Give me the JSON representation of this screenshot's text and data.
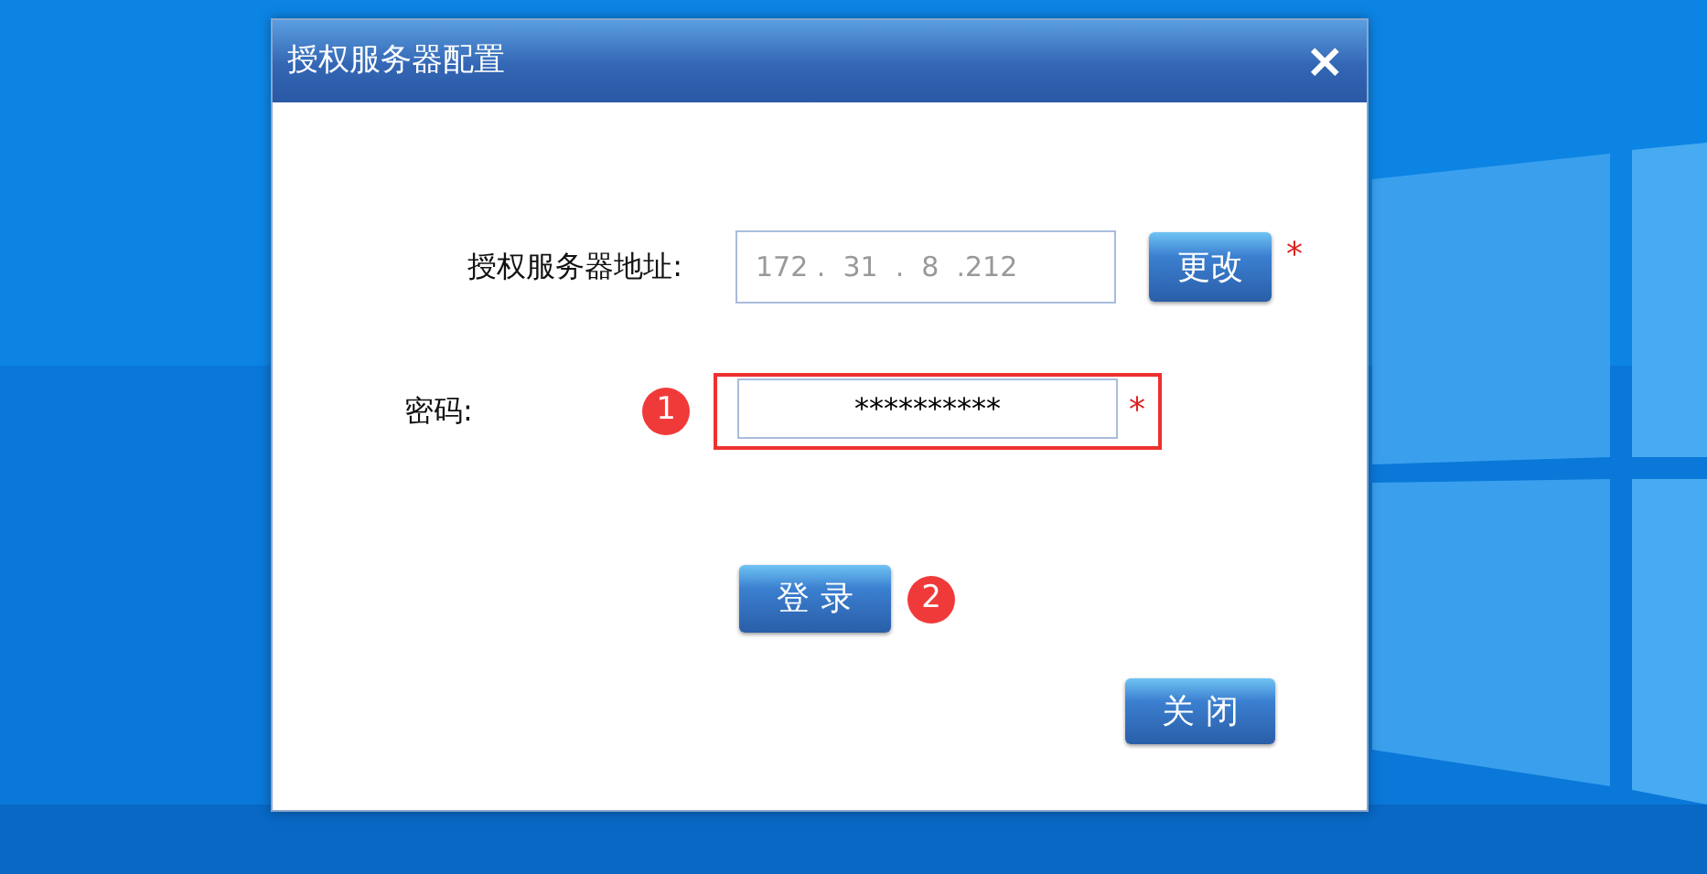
{
  "dialog": {
    "title": "授权服务器配置",
    "close_glyph": "×"
  },
  "address": {
    "label": "授权服务器地址:",
    "value": "172 .  31  .  8  .212",
    "button": "更改",
    "required": "*"
  },
  "password": {
    "label": "密码:",
    "callout": "1",
    "value": "**********",
    "highlighted": true,
    "required": "*"
  },
  "login": {
    "label": "登 录",
    "callout": "2"
  },
  "close_button": {
    "label": "关 闭"
  }
}
